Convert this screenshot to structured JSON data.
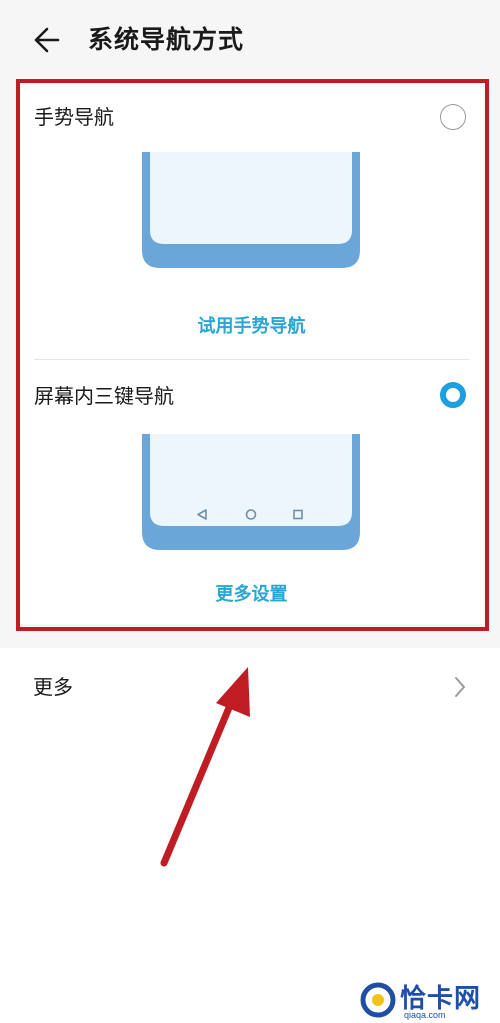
{
  "header": {
    "title": "系统导航方式",
    "back_icon": "arrow-left-icon"
  },
  "options": [
    {
      "label": "手势导航",
      "selected": false,
      "action_label": "试用手势导航"
    },
    {
      "label": "屏幕内三键导航",
      "selected": true,
      "action_label": "更多设置",
      "nav_icons": [
        "triangle-back-icon",
        "circle-home-icon",
        "square-recents-icon"
      ]
    }
  ],
  "more": {
    "label": "更多",
    "chevron_icon": "chevron-right-icon"
  },
  "watermark": {
    "text": "恰卡网",
    "url": "qiaqa.com"
  },
  "colors": {
    "accent": "#1e9fe0",
    "link": "#28a6d4",
    "annotation_red": "#bf1d23",
    "phone_frame": "#6aa7d8",
    "phone_screen": "#eef6fd",
    "watermark_blue": "#1f4fa5"
  }
}
